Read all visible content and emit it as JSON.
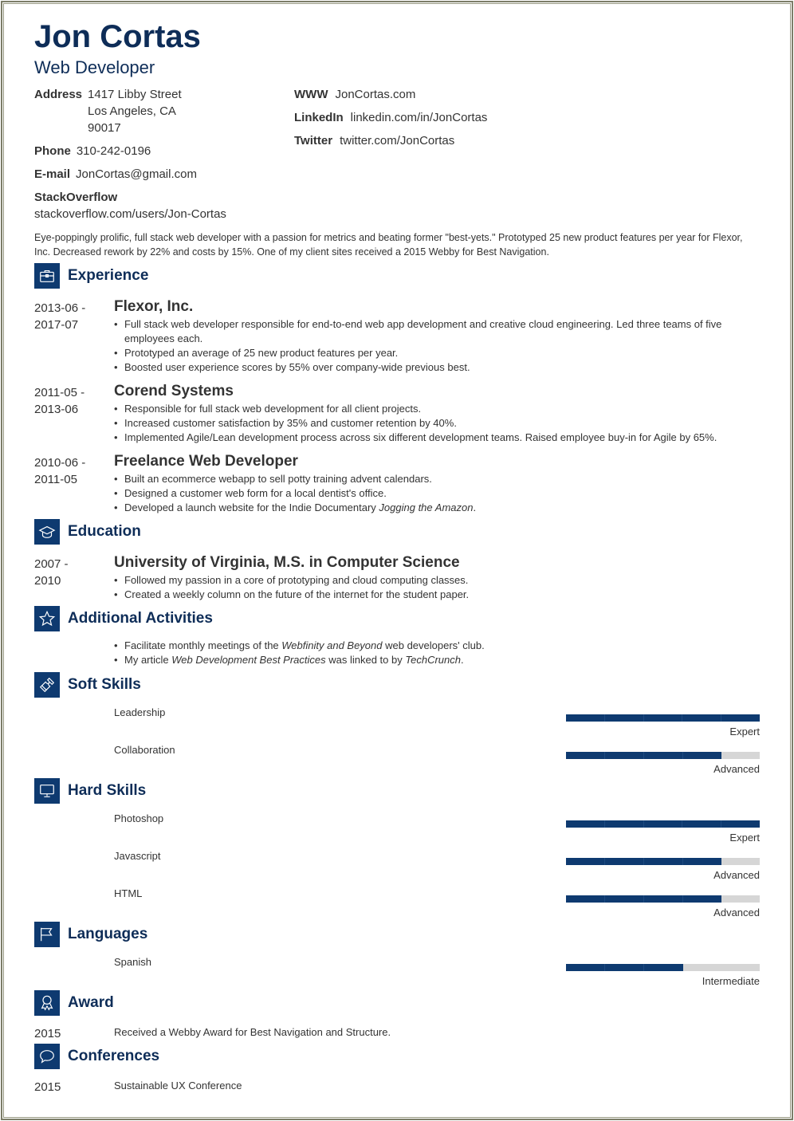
{
  "header": {
    "name": "Jon Cortas",
    "title": "Web Developer"
  },
  "contact": {
    "address_label": "Address",
    "address_lines": [
      "1417 Libby Street",
      "Los Angeles, CA",
      "90017"
    ],
    "phone_label": "Phone",
    "phone": "310-242-0196",
    "email_label": "E-mail",
    "email": "JonCortas@gmail.com",
    "stackoverflow_label": "StackOverflow",
    "stackoverflow": "stackoverflow.com/users/Jon-Cortas",
    "www_label": "WWW",
    "www": "JonCortas.com",
    "linkedin_label": "LinkedIn",
    "linkedin": "linkedin.com/in/JonCortas",
    "twitter_label": "Twitter",
    "twitter": "twitter.com/JonCortas"
  },
  "summary": "Eye-poppingly prolific, full stack web developer with a passion for metrics and beating former \"best-yets.\" Prototyped 25 new product features per year for Flexor, Inc. Decreased rework by 22% and costs by 15%. One of my client sites received a 2015 Webby for Best Navigation.",
  "sections": {
    "experience": {
      "title": "Experience",
      "icon": "briefcase-icon"
    },
    "education": {
      "title": "Education",
      "icon": "graduation-cap-icon"
    },
    "activities": {
      "title": "Additional Activities",
      "icon": "star-icon"
    },
    "soft_skills": {
      "title": "Soft Skills",
      "icon": "puzzle-icon"
    },
    "hard_skills": {
      "title": "Hard Skills",
      "icon": "monitor-icon"
    },
    "languages": {
      "title": "Languages",
      "icon": "flag-icon"
    },
    "award": {
      "title": "Award",
      "icon": "award-ribbon-icon"
    },
    "conferences": {
      "title": "Conferences",
      "icon": "speech-bubble-icon"
    }
  },
  "experience": [
    {
      "date_start": "2013-06 -",
      "date_end": "2017-07",
      "title": "Flexor, Inc.",
      "bullets": [
        [
          {
            "t": "Full stack web developer responsible for end-to-end web app development and creative cloud engineering. Led three teams of five employees each."
          }
        ],
        [
          {
            "t": "Prototyped an average of 25 new product features per year."
          }
        ],
        [
          {
            "t": "Boosted user experience scores by 55% over company-wide previous best."
          }
        ]
      ]
    },
    {
      "date_start": "2011-05 -",
      "date_end": "2013-06",
      "title": "Corend Systems",
      "bullets": [
        [
          {
            "t": "Responsible for full stack web development for all client projects."
          }
        ],
        [
          {
            "t": "Increased customer satisfaction by 35% and customer retention by 40%."
          }
        ],
        [
          {
            "t": "Implemented Agile/Lean development process across six different development teams. Raised employee buy-in for Agile by 65%."
          }
        ]
      ]
    },
    {
      "date_start": "2010-06 -",
      "date_end": "2011-05",
      "title": "Freelance Web Developer",
      "bullets": [
        [
          {
            "t": "Built an ecommerce webapp to sell potty training advent calendars."
          }
        ],
        [
          {
            "t": "Designed a customer web form for a local dentist's office."
          }
        ],
        [
          {
            "t": "Developed a launch website for the Indie Documentary "
          },
          {
            "t": "Jogging the Amazon",
            "i": true
          },
          {
            "t": "."
          }
        ]
      ]
    }
  ],
  "education": [
    {
      "date_start": "2007 -",
      "date_end": "2010",
      "title": "University of Virginia, M.S. in Computer Science",
      "bullets": [
        [
          {
            "t": "Followed my passion in a core of prototyping and cloud computing classes."
          }
        ],
        [
          {
            "t": "Created a weekly column on the future of the internet for the student paper."
          }
        ]
      ]
    }
  ],
  "activities": [
    [
      {
        "t": "Facilitate monthly meetings of the "
      },
      {
        "t": "Webfinity and Beyond",
        "i": true
      },
      {
        "t": " web developers' club."
      }
    ],
    [
      {
        "t": "My article "
      },
      {
        "t": "Web Development Best Practices",
        "i": true
      },
      {
        "t": " was linked to by "
      },
      {
        "t": "TechCrunch",
        "i": true
      },
      {
        "t": "."
      }
    ]
  ],
  "soft_skills": [
    {
      "name": "Leadership",
      "level": "Expert",
      "rating": 5,
      "max": 5
    },
    {
      "name": "Collaboration",
      "level": "Advanced",
      "rating": 4,
      "max": 5
    }
  ],
  "hard_skills": [
    {
      "name": "Photoshop",
      "level": "Expert",
      "rating": 5,
      "max": 5
    },
    {
      "name": "Javascript",
      "level": "Advanced",
      "rating": 4,
      "max": 5
    },
    {
      "name": "HTML",
      "level": "Advanced",
      "rating": 4,
      "max": 5
    }
  ],
  "languages": [
    {
      "name": "Spanish",
      "level": "Intermediate",
      "rating": 3,
      "max": 5
    }
  ],
  "award": [
    {
      "date": "2015",
      "text": "Received a Webby Award for Best Navigation and Structure."
    }
  ],
  "conferences": [
    {
      "date": "2015",
      "text": "Sustainable UX Conference"
    }
  ],
  "colors": {
    "accent": "#0e3a70",
    "heading": "#0e2d58",
    "text": "#333333",
    "bar_empty": "#d6d6d6"
  }
}
